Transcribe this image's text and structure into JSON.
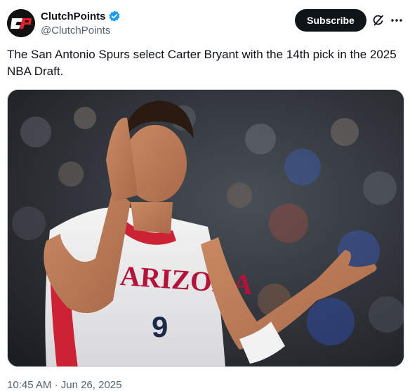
{
  "author": {
    "display_name": "ClutchPoints",
    "handle": "@ClutchPoints",
    "avatar_text": "CP",
    "verified": true
  },
  "actions": {
    "subscribe_label": "Subscribe"
  },
  "tweet": {
    "text": "The San Antonio Spurs select Carter Bryant with the 14th pick in the 2025 NBA Draft."
  },
  "media": {
    "jersey_text": "ARIZONA",
    "jersey_number": "9"
  },
  "meta": {
    "time": "10:45 AM",
    "separator": "·",
    "date": "Jun 26, 2025"
  },
  "colors": {
    "brand_black": "#0f1419",
    "verified_blue": "#1d9bf0",
    "secondary_text": "#536471",
    "clutchpoints_red": "#e4202b"
  },
  "icons": {
    "verified": "verified-badge-icon",
    "grok": "grok-icon",
    "more": "more-icon"
  }
}
